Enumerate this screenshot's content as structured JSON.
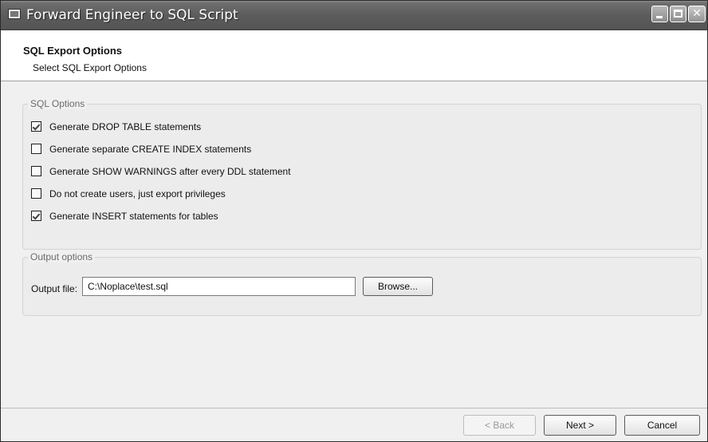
{
  "window": {
    "title": "Forward Engineer to SQL Script",
    "controls": {
      "minimize": "minimize",
      "maximize": "maximize",
      "close": "✕"
    }
  },
  "header": {
    "title": "SQL Export Options",
    "subtitle": "Select SQL Export Options"
  },
  "sql_options": {
    "legend": "SQL Options",
    "items": [
      {
        "label": "Generate DROP TABLE statements",
        "checked": true
      },
      {
        "label": "Generate separate CREATE INDEX statements",
        "checked": false
      },
      {
        "label": "Generate SHOW WARNINGS after every DDL statement",
        "checked": false
      },
      {
        "label": "Do not create users, just export privileges",
        "checked": false
      },
      {
        "label": "Generate INSERT statements for tables",
        "checked": true
      }
    ]
  },
  "output_options": {
    "legend": "Output options",
    "file_label": "Output file:",
    "file_value": "C:\\Noplace\\test.sql",
    "browse_label": "Browse..."
  },
  "footer": {
    "back_label": "< Back",
    "back_enabled": false,
    "next_label": "Next >",
    "cancel_label": "Cancel"
  }
}
